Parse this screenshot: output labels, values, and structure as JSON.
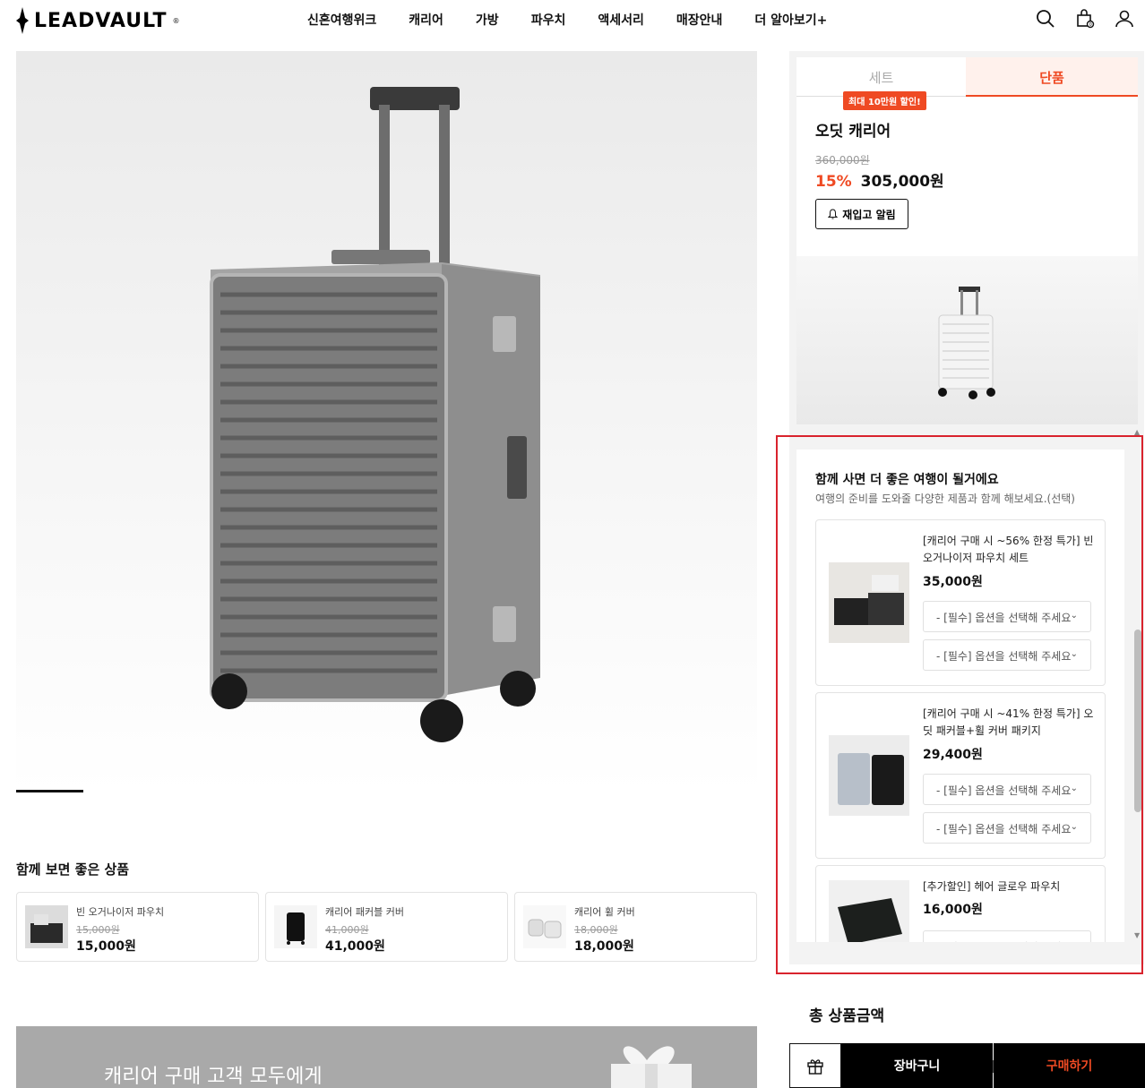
{
  "header": {
    "logo": "LEADVAULT",
    "logo_reg": "®",
    "nav": [
      "신혼여행위크",
      "캐리어",
      "가방",
      "파우치",
      "액세서리",
      "매장안내",
      "더 알아보기+"
    ]
  },
  "related": {
    "title": "함께 보면 좋은 상품",
    "items": [
      {
        "name": "빈 오거나이저 파우치",
        "orig": "15,000원",
        "price": "15,000원"
      },
      {
        "name": "캐리어 패커블 커버",
        "orig": "41,000원",
        "price": "41,000원"
      },
      {
        "name": "캐리어 휠 커버",
        "orig": "18,000원",
        "price": "18,000원"
      }
    ]
  },
  "banner": {
    "text": "캐리어 구매 고객 모두에게"
  },
  "product": {
    "tabs": {
      "set": "세트",
      "single": "단품"
    },
    "promo_badge": "최대 10만원 할인!",
    "name": "오딧 캐리어",
    "orig_price": "360,000원",
    "discount": "15%",
    "price": "305,000원",
    "restock_label": "재입고 알림"
  },
  "recommend": {
    "title": "함께 사면 더 좋은 여행이 될거에요",
    "subtitle": "여행의 준비를 도와줄 다양한 제품과 함께 해보세요.(선택)",
    "option_placeholder": "- [필수] 옵션을 선택해 주세요",
    "items": [
      {
        "name": "[캐리어 구매 시 ~56% 한정 특가] 빈 오거나이저 파우치 세트",
        "price": "35,000원"
      },
      {
        "name": "[캐리어 구매 시 ~41% 한정 특가] 오딧 패커블+휠 커버 패키지",
        "price": "29,400원"
      },
      {
        "name": "[추가할인] 헤어 글로우 파우치",
        "price": "16,000원"
      }
    ]
  },
  "purchase": {
    "total_label": "총 상품금액",
    "cart": "장바구니",
    "buy": "구매하기"
  },
  "colors": {
    "accent": "#ef4a23",
    "highlight": "#d9232d"
  }
}
